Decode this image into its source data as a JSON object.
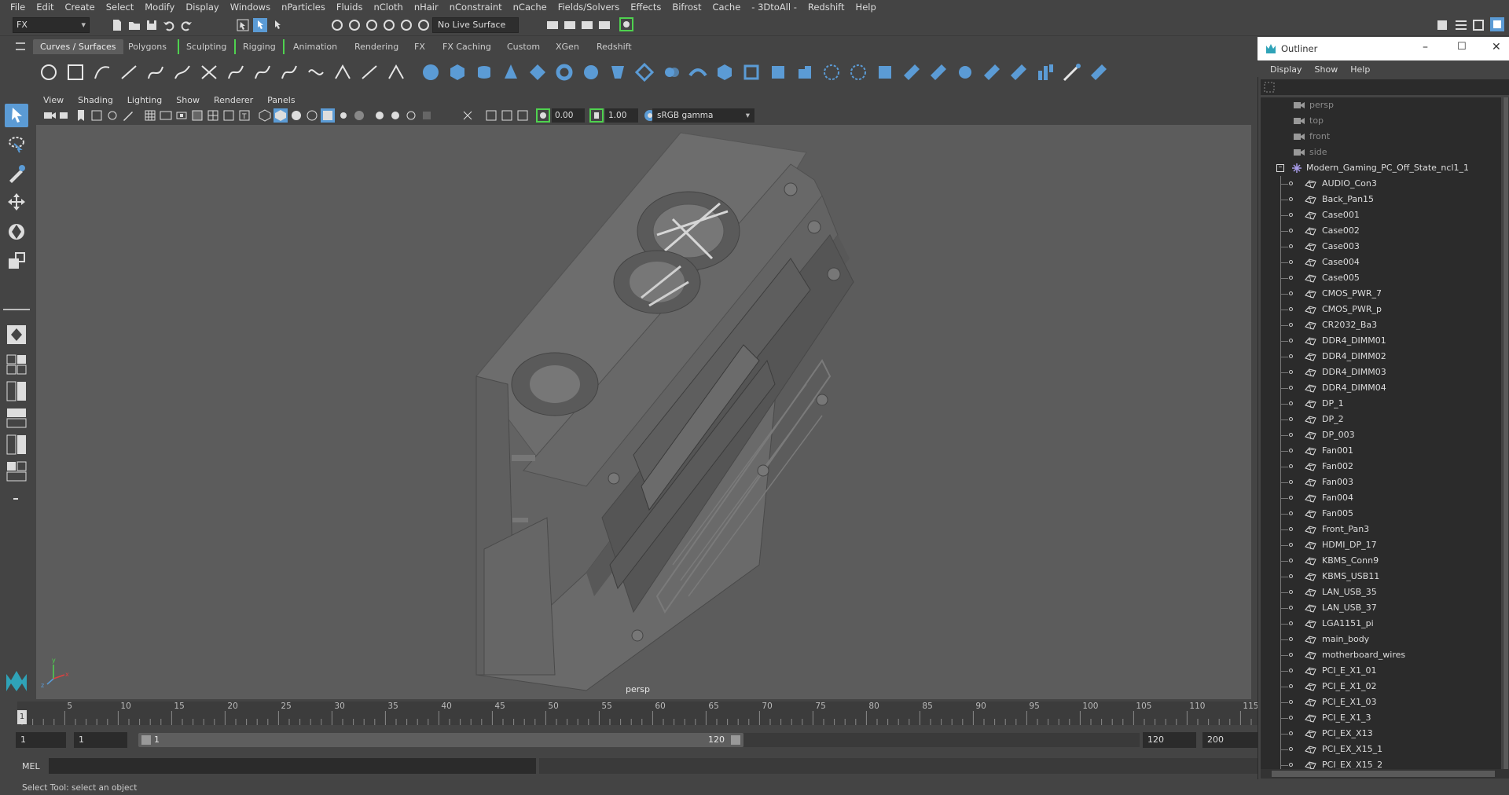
{
  "menu": [
    "File",
    "Edit",
    "Create",
    "Select",
    "Modify",
    "Display",
    "Windows",
    "nParticles",
    "Fluids",
    "nCloth",
    "nHair",
    "nConstraint",
    "nCache",
    "Fields/Solvers",
    "Effects",
    "Bifrost",
    "Cache",
    "- 3DtoAll -",
    "Redshift",
    "Help"
  ],
  "status_line": {
    "mode": "FX",
    "live_surface": "No Live Surface"
  },
  "shelf_tabs": [
    {
      "label": "Curves / Surfaces",
      "active": true
    },
    {
      "label": "Polygons"
    },
    {
      "label": "Sculpting"
    },
    {
      "label": "Rigging"
    },
    {
      "label": "Animation"
    },
    {
      "label": "Rendering"
    },
    {
      "label": "FX"
    },
    {
      "label": "FX Caching"
    },
    {
      "label": "Custom"
    },
    {
      "label": "XGen"
    },
    {
      "label": "Redshift"
    }
  ],
  "panel_menu": [
    "View",
    "Shading",
    "Lighting",
    "Show",
    "Renderer",
    "Panels"
  ],
  "panel_bar": {
    "exposure": "0.00",
    "gamma": "1.00",
    "color_space": "sRGB gamma"
  },
  "viewport": {
    "camera_label": "persp",
    "colors": {
      "background": "#5c5c5c",
      "model": "#6a6a6a"
    }
  },
  "timeline": {
    "ticks": [
      "5",
      "10",
      "15",
      "20",
      "25",
      "30",
      "35",
      "40",
      "45",
      "50",
      "55",
      "60",
      "65",
      "70",
      "75",
      "80",
      "85",
      "90",
      "95",
      "100",
      "105",
      "110",
      "115"
    ],
    "current_frame": "1"
  },
  "range": {
    "start_time": "1",
    "playback_start": "1",
    "slider_start": "1",
    "slider_end": "120",
    "playback_end": "120",
    "end_time": "200"
  },
  "command_line": {
    "language": "MEL"
  },
  "help_line": "Select Tool: select an object",
  "outliner": {
    "title": "Outliner",
    "menu": [
      "Display",
      "Show",
      "Help"
    ],
    "cameras": [
      "persp",
      "top",
      "front",
      "side"
    ],
    "group": "Modern_Gaming_PC_Off_State_ncl1_1",
    "items": [
      "AUDIO_Con3",
      "Back_Pan15",
      "Case001",
      "Case002",
      "Case003",
      "Case004",
      "Case005",
      "CMOS_PWR_7",
      "CMOS_PWR_p",
      "CR2032_Ba3",
      "DDR4_DIMM01",
      "DDR4_DIMM02",
      "DDR4_DIMM03",
      "DDR4_DIMM04",
      "DP_1",
      "DP_2",
      "DP_003",
      "Fan001",
      "Fan002",
      "Fan003",
      "Fan004",
      "Fan005",
      "Front_Pan3",
      "HDMI_DP_17",
      "KBMS_Conn9",
      "KBMS_USB11",
      "LAN_USB_35",
      "LAN_USB_37",
      "LGA1151_pi",
      "main_body",
      "motherboard_wires",
      "PCI_E_X1_01",
      "PCI_E_X1_02",
      "PCI_E_X1_03",
      "PCI_E_X1_3",
      "PCI_EX_X13",
      "PCI_EX_X15_1",
      "PCI_EX_X15_2"
    ]
  },
  "accent_color": "#5b9bd5"
}
